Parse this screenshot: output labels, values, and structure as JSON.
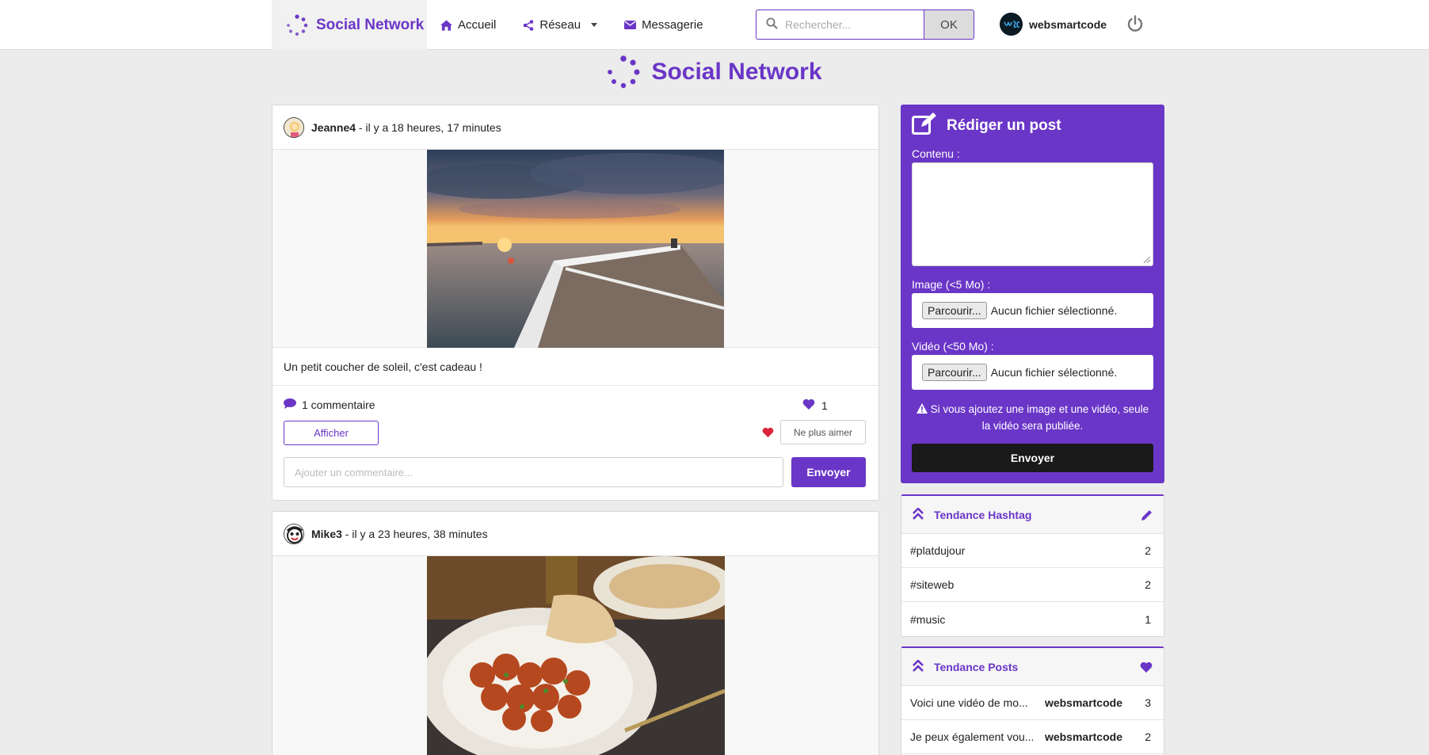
{
  "brand": {
    "name": "Social Network"
  },
  "nav": {
    "items": [
      {
        "label": "Accueil",
        "icon": "home-icon"
      },
      {
        "label": "Réseau",
        "icon": "share-icon"
      },
      {
        "label": "Messagerie",
        "icon": "envelope-icon"
      }
    ],
    "search_placeholder": "Rechercher...",
    "search_button": "OK",
    "user_name": "websmartcode"
  },
  "page_title": "Social Network",
  "posts": [
    {
      "author": "Jeanne4",
      "time": " - il y a 18 heures, 17 minutes",
      "text": "Un petit coucher de soleil, c'est cadeau !",
      "comments": "1 commentaire",
      "likes": "1",
      "show_label": "Afficher",
      "unlike_label": "Ne plus aimer",
      "comment_placeholder": "Ajouter un commentaire...",
      "send_label": "Envoyer"
    },
    {
      "author": "Mike3",
      "time": " - il y a 23 heures, 38 minutes"
    }
  ],
  "compose": {
    "title": "Rédiger un post",
    "content_label": "Contenu :",
    "image_label": "Image (<5 Mo) :",
    "video_label": "Vidéo (<50 Mo) :",
    "browse_label": "Parcourir...",
    "no_file": "Aucun fichier sélectionné.",
    "warning": "Si vous ajoutez une image et une vidéo, seule la vidéo sera publiée.",
    "submit": "Envoyer"
  },
  "trend_hashtag": {
    "title": "Tendance Hashtag",
    "rows": [
      {
        "tag": "#platdujour",
        "count": "2"
      },
      {
        "tag": "#siteweb",
        "count": "2"
      },
      {
        "tag": "#music",
        "count": "1"
      }
    ]
  },
  "trend_posts": {
    "title": "Tendance Posts",
    "rows": [
      {
        "text": "Voici une vidéo de mo...",
        "author": "websmartcode",
        "count": "3"
      },
      {
        "text": "Je peux également vou...",
        "author": "websmartcode",
        "count": "2"
      }
    ]
  },
  "colors": {
    "accent": "#6a36c7",
    "like": "#d9263a",
    "dark_button": "#1a1a1a"
  }
}
